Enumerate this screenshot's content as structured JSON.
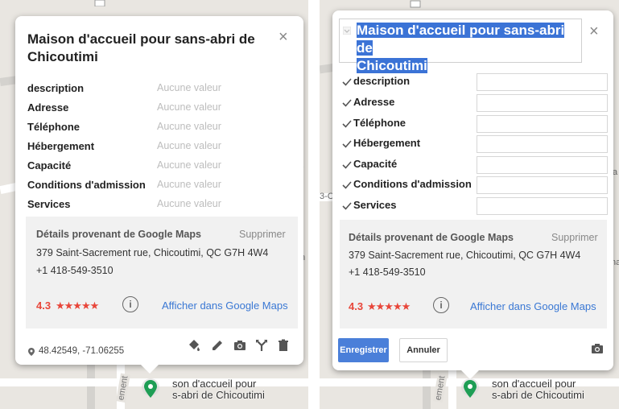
{
  "place_title_line1": "Maison d'accueil pour sans-abri de",
  "place_title_line2": "Chicoutimi",
  "close_symbol": "×",
  "fields": [
    {
      "key": "description",
      "value": "Aucune valeur"
    },
    {
      "key": "Adresse",
      "value": "Aucune valeur"
    },
    {
      "key": "Téléphone",
      "value": "Aucune valeur"
    },
    {
      "key": "Hébergement",
      "value": "Aucune valeur"
    },
    {
      "key": "Capacité",
      "value": "Aucune valeur"
    },
    {
      "key": "Conditions d'admission",
      "value": "Aucune valeur"
    },
    {
      "key": "Services",
      "value": "Aucune valeur"
    }
  ],
  "google": {
    "header": "Détails provenant de Google Maps",
    "delete": "Supprimer",
    "address": "379 Saint-Sacrement rue, Chicoutimi, QC G7H 4W4",
    "phone": "+1 418-549-3510",
    "rating": "4.3",
    "stars": "★★★★★",
    "rating_value": 4.3,
    "link": "Afficher dans Google Maps"
  },
  "coords": "48.42549, -71.06255",
  "toolbar_icons": [
    "paint-bucket-icon",
    "pencil-icon",
    "camera-icon",
    "directions-icon",
    "trash-icon"
  ],
  "edit": {
    "save": "Enregistrer",
    "cancel": "Annuler"
  },
  "map": {
    "marker_label_line1": "son d'accueil pour",
    "marker_label_line2": "s-abri de Chicoutimi",
    "road_label": "ement",
    "edge_letters_left": [
      "s",
      "n"
    ],
    "edge_letters_right": [
      "a",
      "na"
    ],
    "edge_snippet_right": "3-C"
  },
  "colors": {
    "accent_blue": "#4a7fd9",
    "rating_red": "#e8463a",
    "link_blue": "#3a78d4",
    "marker_green": "#1e9e55"
  }
}
